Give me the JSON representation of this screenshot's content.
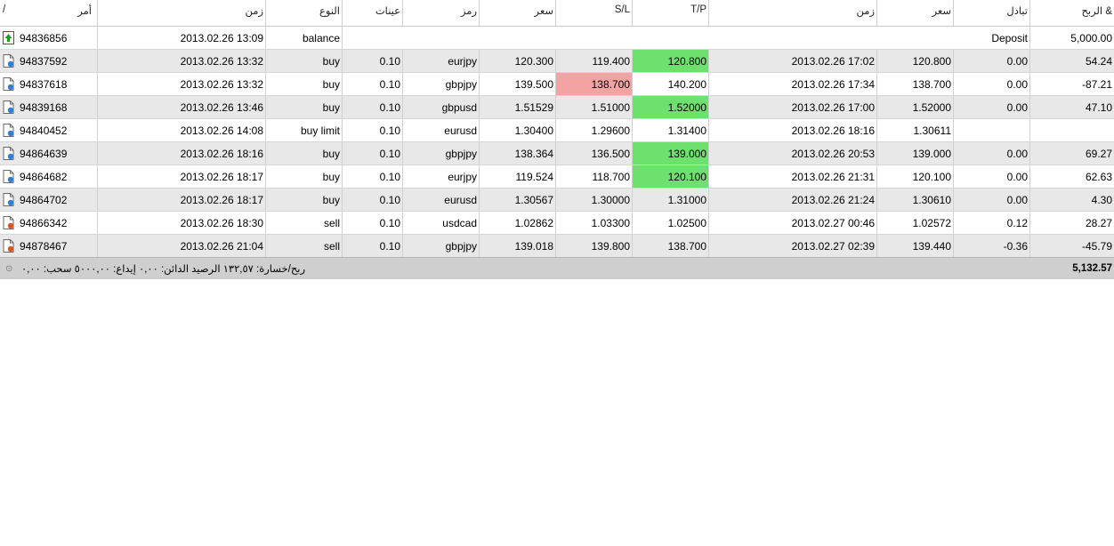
{
  "columns": {
    "order": "أمر",
    "sort_marker": "/",
    "open_time": "زمن",
    "type": "النوع",
    "volume": "عينات",
    "symbol": "رمز",
    "open_price": "سعر",
    "sl": "S/L",
    "tp": "T/P",
    "close_time": "زمن",
    "close_price": "سعر",
    "swap": "تبادل",
    "profit": "الربح &"
  },
  "balance_row": {
    "order": "94836856",
    "time": "2013.02.26 13:09",
    "type": "balance",
    "comment": "Deposit",
    "profit": "5,000.00",
    "icon": "deposit-arrow-icon"
  },
  "trades": [
    {
      "order": "94837592",
      "open_time": "2013.02.26 13:32",
      "type": "buy",
      "volume": "0.10",
      "symbol": "eurjpy",
      "open_price": "120.300",
      "sl": "119.400",
      "tp": "120.800",
      "close_time": "2013.02.26 17:02",
      "close_price": "120.800",
      "swap": "0.00",
      "profit": "54.24",
      "icon": "buy-order-icon",
      "highlight": "tp"
    },
    {
      "order": "94837618",
      "open_time": "2013.02.26 13:32",
      "type": "buy",
      "volume": "0.10",
      "symbol": "gbpjpy",
      "open_price": "139.500",
      "sl": "138.700",
      "tp": "140.200",
      "close_time": "2013.02.26 17:34",
      "close_price": "138.700",
      "swap": "0.00",
      "profit": "-87.21",
      "icon": "buy-order-icon",
      "highlight": "sl"
    },
    {
      "order": "94839168",
      "open_time": "2013.02.26 13:46",
      "type": "buy",
      "volume": "0.10",
      "symbol": "gbpusd",
      "open_price": "1.51529",
      "sl": "1.51000",
      "tp": "1.52000",
      "close_time": "2013.02.26 17:00",
      "close_price": "1.52000",
      "swap": "0.00",
      "profit": "47.10",
      "icon": "buy-order-icon",
      "highlight": "tp"
    },
    {
      "order": "94840452",
      "open_time": "2013.02.26 14:08",
      "type": "buy limit",
      "volume": "0.10",
      "symbol": "eurusd",
      "open_price": "1.30400",
      "sl": "1.29600",
      "tp": "1.31400",
      "close_time": "2013.02.26 18:16",
      "close_price": "1.30611",
      "swap": "",
      "profit": "",
      "icon": "buy-order-icon",
      "highlight": ""
    },
    {
      "order": "94864639",
      "open_time": "2013.02.26 18:16",
      "type": "buy",
      "volume": "0.10",
      "symbol": "gbpjpy",
      "open_price": "138.364",
      "sl": "136.500",
      "tp": "139.000",
      "close_time": "2013.02.26 20:53",
      "close_price": "139.000",
      "swap": "0.00",
      "profit": "69.27",
      "icon": "buy-order-icon",
      "highlight": "tp"
    },
    {
      "order": "94864682",
      "open_time": "2013.02.26 18:17",
      "type": "buy",
      "volume": "0.10",
      "symbol": "eurjpy",
      "open_price": "119.524",
      "sl": "118.700",
      "tp": "120.100",
      "close_time": "2013.02.26 21:31",
      "close_price": "120.100",
      "swap": "0.00",
      "profit": "62.63",
      "icon": "buy-order-icon",
      "highlight": "tp"
    },
    {
      "order": "94864702",
      "open_time": "2013.02.26 18:17",
      "type": "buy",
      "volume": "0.10",
      "symbol": "eurusd",
      "open_price": "1.30567",
      "sl": "1.30000",
      "tp": "1.31000",
      "close_time": "2013.02.26 21:24",
      "close_price": "1.30610",
      "swap": "0.00",
      "profit": "4.30",
      "icon": "buy-order-icon",
      "highlight": ""
    },
    {
      "order": "94866342",
      "open_time": "2013.02.26 18:30",
      "type": "sell",
      "volume": "0.10",
      "symbol": "usdcad",
      "open_price": "1.02862",
      "sl": "1.03300",
      "tp": "1.02500",
      "close_time": "2013.02.27 00:46",
      "close_price": "1.02572",
      "swap": "0.12",
      "profit": "28.27",
      "icon": "sell-order-icon",
      "highlight": ""
    },
    {
      "order": "94878467",
      "open_time": "2013.02.26 21:04",
      "type": "sell",
      "volume": "0.10",
      "symbol": "gbpjpy",
      "open_price": "139.018",
      "sl": "139.800",
      "tp": "138.700",
      "close_time": "2013.02.27 02:39",
      "close_price": "139.440",
      "swap": "-0.36",
      "profit": "-45.79",
      "icon": "sell-order-icon",
      "highlight": ""
    }
  ],
  "footer": {
    "summary": "ربح/خسارة: ١٣٢,٥٧  الرصيد الدائن: ٠,٠٠  إيداع: ٥٠٠٠,٠٠  سحب: ٠,٠٠",
    "total": "5,132.57",
    "grip_icon": "status-grip-icon"
  },
  "colors": {
    "tp_hit": "#6ee06e",
    "sl_hit": "#f4a3a3",
    "alt_row": "#e8e8e8",
    "footer_bg": "#cfcfcf"
  }
}
